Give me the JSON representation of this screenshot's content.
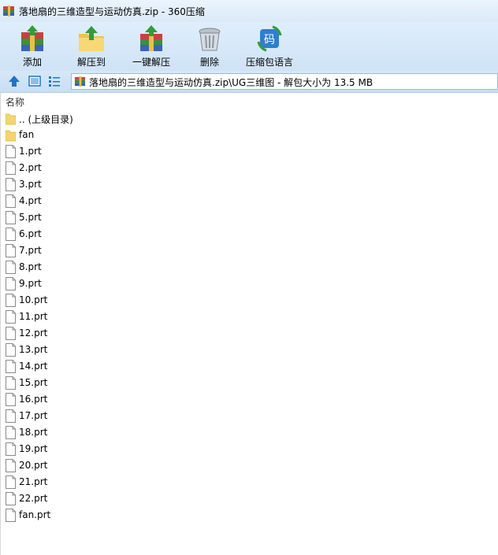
{
  "window": {
    "title": "落地扇的三维造型与运动仿真.zip - 360压缩"
  },
  "toolbar": {
    "buttons": [
      {
        "label": "添加",
        "icon": "add-archive-icon"
      },
      {
        "label": "解压到",
        "icon": "extract-to-icon"
      },
      {
        "label": "一键解压",
        "icon": "one-click-extract-icon"
      },
      {
        "label": "删除",
        "icon": "trash-icon"
      },
      {
        "label": "压缩包语言",
        "icon": "encoding-icon"
      }
    ],
    "encoding_glyph": "码"
  },
  "address_bar": {
    "path": "落地扇的三维造型与运动仿真.zip\\UG三维图 - 解包大小为 13.5 MB"
  },
  "file_list": {
    "column_header": "名称",
    "items": [
      {
        "name": ".. (上级目录)",
        "type": "folder"
      },
      {
        "name": "fan",
        "type": "folder"
      },
      {
        "name": "1.prt",
        "type": "file"
      },
      {
        "name": "2.prt",
        "type": "file"
      },
      {
        "name": "3.prt",
        "type": "file"
      },
      {
        "name": "4.prt",
        "type": "file"
      },
      {
        "name": "5.prt",
        "type": "file"
      },
      {
        "name": "6.prt",
        "type": "file"
      },
      {
        "name": "7.prt",
        "type": "file"
      },
      {
        "name": "8.prt",
        "type": "file"
      },
      {
        "name": "9.prt",
        "type": "file"
      },
      {
        "name": "10.prt",
        "type": "file"
      },
      {
        "name": "11.prt",
        "type": "file"
      },
      {
        "name": "12.prt",
        "type": "file"
      },
      {
        "name": "13.prt",
        "type": "file"
      },
      {
        "name": "14.prt",
        "type": "file"
      },
      {
        "name": "15.prt",
        "type": "file"
      },
      {
        "name": "16.prt",
        "type": "file"
      },
      {
        "name": "17.prt",
        "type": "file"
      },
      {
        "name": "18.prt",
        "type": "file"
      },
      {
        "name": "19.prt",
        "type": "file"
      },
      {
        "name": "20.prt",
        "type": "file"
      },
      {
        "name": "21.prt",
        "type": "file"
      },
      {
        "name": "22.prt",
        "type": "file"
      },
      {
        "name": "fan.prt",
        "type": "file"
      }
    ]
  },
  "colors": {
    "toolbar_bg": "#d6e8f8",
    "folder": "#f6d56a",
    "accent": "#1e74c8"
  }
}
